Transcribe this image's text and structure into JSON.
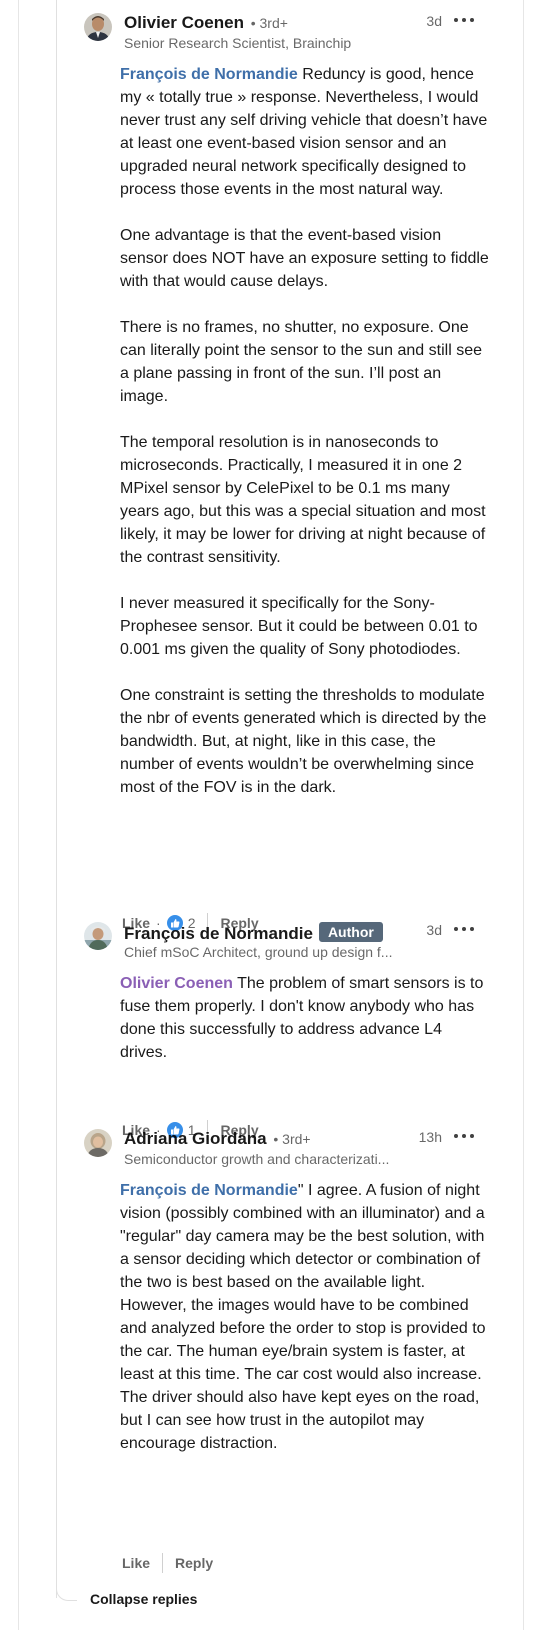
{
  "comments": [
    {
      "author": "Olivier Coenen",
      "degree": "• 3rd+",
      "headline": "Senior Research Scientist, Brainchip",
      "time": "3d",
      "mention": "François de Normandie",
      "paragraphs": [
        " Reduncy is good, hence my « totally true » response. Nevertheless, I would never trust any self driving vehicle that doesn’t have at least one event-based vision sensor and an upgraded neural network specifically designed to process those events in the most natural way.",
        "One advantage is that the event-based vision sensor does NOT have an exposure setting to fiddle with that would cause delays.",
        "There is no frames, no shutter, no exposure. One can literally point the sensor to the sun and still see a plane passing in front of the sun. I’ll post an image.",
        "The temporal resolution is in nanoseconds to microseconds. Practically, I measured it in one 2 MPixel sensor by CelePixel to be 0.1 ms many years ago, but this was a special situation and most likely, it may be lower for driving at night because of the contrast sensitivity.",
        "I never measured it specifically for the Sony-Prophesee sensor. But it could be between 0.01 to 0.001 ms given the quality of Sony photodiodes.",
        "One constraint is setting the thresholds to modulate the nbr of events generated which is directed by the bandwidth. But, at night, like in this case, the number of events wouldn’t be overwhelming since most of the FOV is in the dark."
      ],
      "like_label": "Like",
      "reaction_count": "2",
      "reply_label": "Reply"
    },
    {
      "author": "François de Normandie",
      "badge": "Author",
      "headline": "Chief mSoC Architect, ground up design f...",
      "time": "3d",
      "mention": "Olivier Coenen",
      "paragraphs": [
        " The problem of smart sensors is to fuse them properly. I don't know anybody who has done this successfully to address advance L4 drives."
      ],
      "like_label": "Like",
      "reaction_count": "1",
      "reply_label": "Reply"
    },
    {
      "author": "Adriana Giordana",
      "degree": "• 3rd+",
      "headline": "Semiconductor growth and characterizati...",
      "time": "13h",
      "mention": "François de Normandie",
      "paragraphs": [
        "\" I agree. A fusion of night vision (possibly combined with an illuminator) and a \"regular\" day camera may be the best solution, with a sensor deciding which detector or combination of the two is best based on the available light. However, the images would have to be combined and analyzed before the order to stop is provided to the car. The human eye/brain system is faster, at least at this time. The car cost would also increase. The driver should also have kept eyes on the road, but I can see how trust in the autopilot may encourage distraction."
      ],
      "like_label": "Like",
      "reply_label": "Reply"
    }
  ],
  "collapse_label": "Collapse replies",
  "colors": {
    "mention_blue": "#3f6fa9",
    "mention_purple": "#8a5fb5",
    "author_badge_bg": "#56687a",
    "like_icon": "#378fe9"
  }
}
